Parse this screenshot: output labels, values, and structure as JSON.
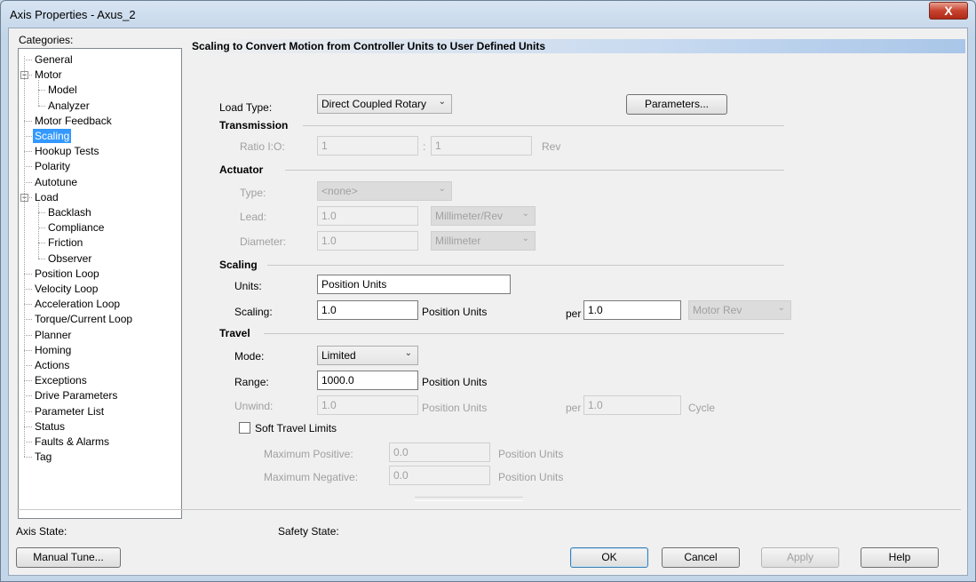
{
  "window": {
    "title": "Axis Properties - Axus_2",
    "close_glyph": "X"
  },
  "categories_label": "Categories:",
  "tree": [
    {
      "label": "General"
    },
    {
      "label": "Motor",
      "expander": "−"
    },
    {
      "label": "Model"
    },
    {
      "label": "Analyzer"
    },
    {
      "label": "Motor Feedback"
    },
    {
      "label": "Scaling",
      "selected": true
    },
    {
      "label": "Hookup Tests"
    },
    {
      "label": "Polarity"
    },
    {
      "label": "Autotune"
    },
    {
      "label": "Load",
      "expander": "−"
    },
    {
      "label": "Backlash"
    },
    {
      "label": "Compliance"
    },
    {
      "label": "Friction"
    },
    {
      "label": "Observer"
    },
    {
      "label": "Position Loop"
    },
    {
      "label": "Velocity Loop"
    },
    {
      "label": "Acceleration Loop"
    },
    {
      "label": "Torque/Current Loop"
    },
    {
      "label": "Planner"
    },
    {
      "label": "Homing"
    },
    {
      "label": "Actions"
    },
    {
      "label": "Exceptions"
    },
    {
      "label": "Drive Parameters"
    },
    {
      "label": "Parameter List"
    },
    {
      "label": "Status"
    },
    {
      "label": "Faults & Alarms"
    },
    {
      "label": "Tag"
    }
  ],
  "header": "Scaling to Convert Motion from Controller Units to User Defined Units",
  "load_type": {
    "label": "Load Type:",
    "value": "Direct Coupled Rotary",
    "parameters_button": "Parameters..."
  },
  "transmission": {
    "title": "Transmission",
    "ratio_label": "Ratio I:O:",
    "ratio_in": "1",
    "separator": ":",
    "ratio_out": "1",
    "unit": "Rev"
  },
  "actuator": {
    "title": "Actuator",
    "type_label": "Type:",
    "type_value": "<none>",
    "lead_label": "Lead:",
    "lead_value": "1.0",
    "lead_unit": "Millimeter/Rev",
    "diameter_label": "Diameter:",
    "diameter_value": "1.0",
    "diameter_unit": "Millimeter"
  },
  "scaling": {
    "title": "Scaling",
    "units_label": "Units:",
    "units_value": "Position Units",
    "scaling_label": "Scaling:",
    "scaling_value": "1.0",
    "scaling_unit": "Position Units",
    "per_label": "per",
    "per_value": "1.0",
    "per_unit": "Motor Rev"
  },
  "travel": {
    "title": "Travel",
    "mode_label": "Mode:",
    "mode_value": "Limited",
    "range_label": "Range:",
    "range_value": "1000.0",
    "range_unit": "Position Units",
    "unwind_label": "Unwind:",
    "unwind_value": "1.0",
    "unwind_unit": "Position Units",
    "unwind_per_label": "per",
    "unwind_per_value": "1.0",
    "unwind_per_unit": "Cycle",
    "soft_limits_label": "Soft Travel Limits",
    "max_pos_label": "Maximum Positive:",
    "max_pos_value": "0.0",
    "max_pos_unit": "Position Units",
    "max_neg_label": "Maximum Negative:",
    "max_neg_value": "0.0",
    "max_neg_unit": "Position Units"
  },
  "status": {
    "axis_state_label": "Axis State:",
    "safety_state_label": "Safety State:"
  },
  "buttons": {
    "manual_tune": "Manual Tune...",
    "ok": "OK",
    "cancel": "Cancel",
    "apply": "Apply",
    "help": "Help"
  },
  "icons": {
    "dropdown_arrow": "chevron-down-icon",
    "expander": "tree-collapse-icon",
    "close": "close-icon"
  }
}
